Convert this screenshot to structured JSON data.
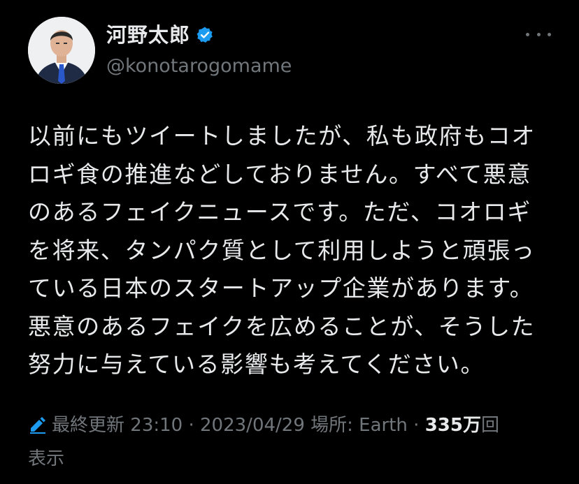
{
  "author": {
    "display_name": "河野太郎",
    "handle": "@konotarogomame",
    "verified": true
  },
  "tweet": {
    "text": "以前にもツイートしましたが、私も政府もコオロギ食の推進などしておりません。すべて悪意のあるフェイクニュースです。ただ、コオロギを将来、タンパク質として利用しようと頑張っている日本のスタートアップ企業があります。悪意のあるフェイクを広めることが、そうした努力に与えている影響も考えてください。"
  },
  "meta": {
    "edited_label": "最終更新",
    "time": "23:10",
    "separator": "·",
    "date": "2023/04/29",
    "location_label": "場所: Earth",
    "views_count": "335万",
    "views_suffix_1": "回",
    "views_suffix_2": "表示"
  },
  "icons": {
    "verified": "verified-badge-icon",
    "edit": "pencil-edit-icon",
    "more": "more-options-icon"
  },
  "colors": {
    "background": "#000000",
    "text_primary": "#e7e9ea",
    "text_secondary": "#71767b",
    "verified_blue": "#1d9bf0"
  }
}
